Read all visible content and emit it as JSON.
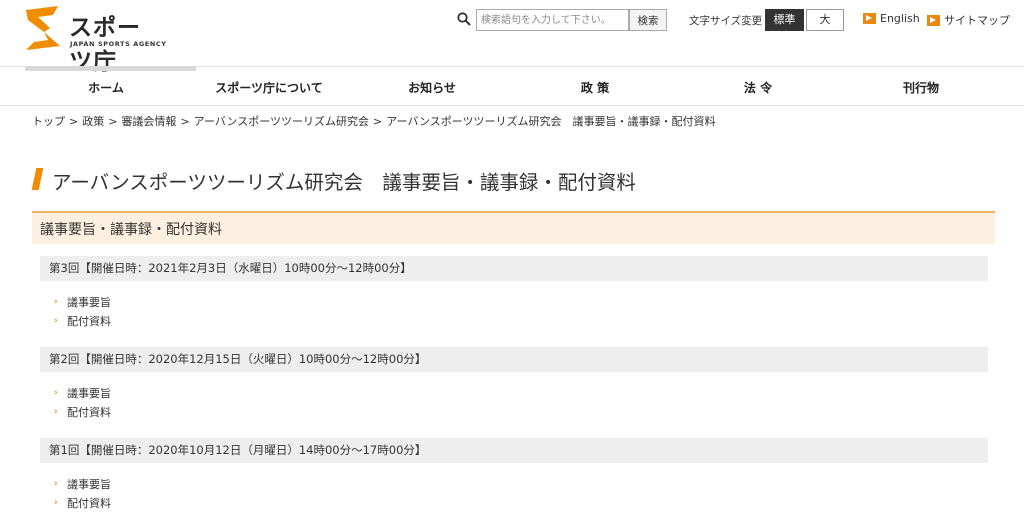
{
  "header": {
    "logo_text": "スポーツ庁",
    "logo_sub": "JAPAN SPORTS AGENCY",
    "search_placeholder": "検索語句を入力して下さい。",
    "search_button": "検索",
    "font_size_label": "文字サイズ変更",
    "font_standard": "標準",
    "font_large": "大",
    "english_link": "English",
    "sitemap_link": "サイトマップ"
  },
  "nav": {
    "items": [
      "ホーム",
      "スポーツ庁について",
      "お知らせ",
      "政 策",
      "法 令",
      "刊行物"
    ]
  },
  "breadcrumb": [
    "トップ",
    "政策",
    "審議会情報",
    "アーバンスポーツツーリズム研究会",
    "アーバンスポーツツーリズム研究会　議事要旨・議事録・配付資料"
  ],
  "breadcrumb_sep": ">",
  "page_title": "アーバンスポーツツーリズム研究会　議事要旨・議事録・配付資料",
  "section_title": "議事要旨・議事録・配付資料",
  "meetings": [
    {
      "heading": "第3回【開催日時：2021年2月3日（水曜日）10時00分～12時00分】",
      "links": [
        "議事要旨",
        "配付資料"
      ]
    },
    {
      "heading": "第2回【開催日時：2020年12月15日（火曜日）10時00分～12時00分】",
      "links": [
        "議事要旨",
        "配付資料"
      ]
    },
    {
      "heading": "第1回【開催日時：2020年10月12日（月曜日）14時00分～17時00分】",
      "links": [
        "議事要旨",
        "配付資料"
      ]
    }
  ],
  "colors": {
    "accent": "#f08c00",
    "section_bg": "#fdf0e0",
    "meeting_bg": "#eeeeee"
  },
  "icons": {
    "search": "search-icon",
    "link_bullet": "chevron-right-icon",
    "external": "arrow-right-icon"
  }
}
